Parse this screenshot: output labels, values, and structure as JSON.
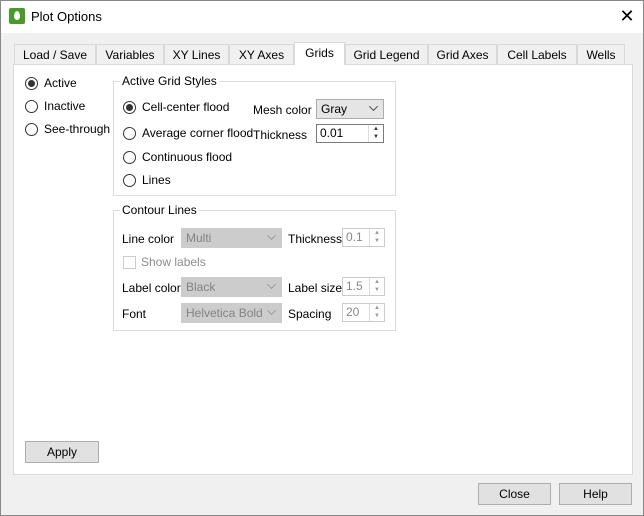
{
  "window": {
    "title": "Plot Options",
    "close": "✕"
  },
  "tabs": [
    {
      "label": "Load / Save"
    },
    {
      "label": "Variables"
    },
    {
      "label": "XY Lines"
    },
    {
      "label": "XY Axes"
    },
    {
      "label": "Grids",
      "selected": true
    },
    {
      "label": "Grid Legend"
    },
    {
      "label": "Grid Axes"
    },
    {
      "label": "Cell Labels"
    },
    {
      "label": "Wells"
    }
  ],
  "mode": {
    "options": [
      "Active",
      "Inactive",
      "See-through"
    ],
    "selected": "Active"
  },
  "active_grid_styles": {
    "title": "Active Grid Styles",
    "options": [
      "Cell-center flood",
      "Average corner flood",
      "Continuous flood",
      "Lines"
    ],
    "selected": "Cell-center flood",
    "mesh_color_label": "Mesh color",
    "mesh_color": "Gray",
    "thickness_label": "Thickness",
    "thickness": "0.01"
  },
  "contour_lines": {
    "title": "Contour Lines",
    "line_color_label": "Line color",
    "line_color": "Multi",
    "thickness_label": "Thickness",
    "thickness": "0.1",
    "show_labels": "Show labels",
    "show_labels_checked": false,
    "label_color_label": "Label color",
    "label_color": "Black",
    "label_size_label": "Label size",
    "label_size": "1.5",
    "font_label": "Font",
    "font": "Helvetica Bold",
    "spacing_label": "Spacing",
    "spacing": "20"
  },
  "buttons": {
    "apply": "Apply",
    "close": "Close",
    "help": "Help"
  }
}
